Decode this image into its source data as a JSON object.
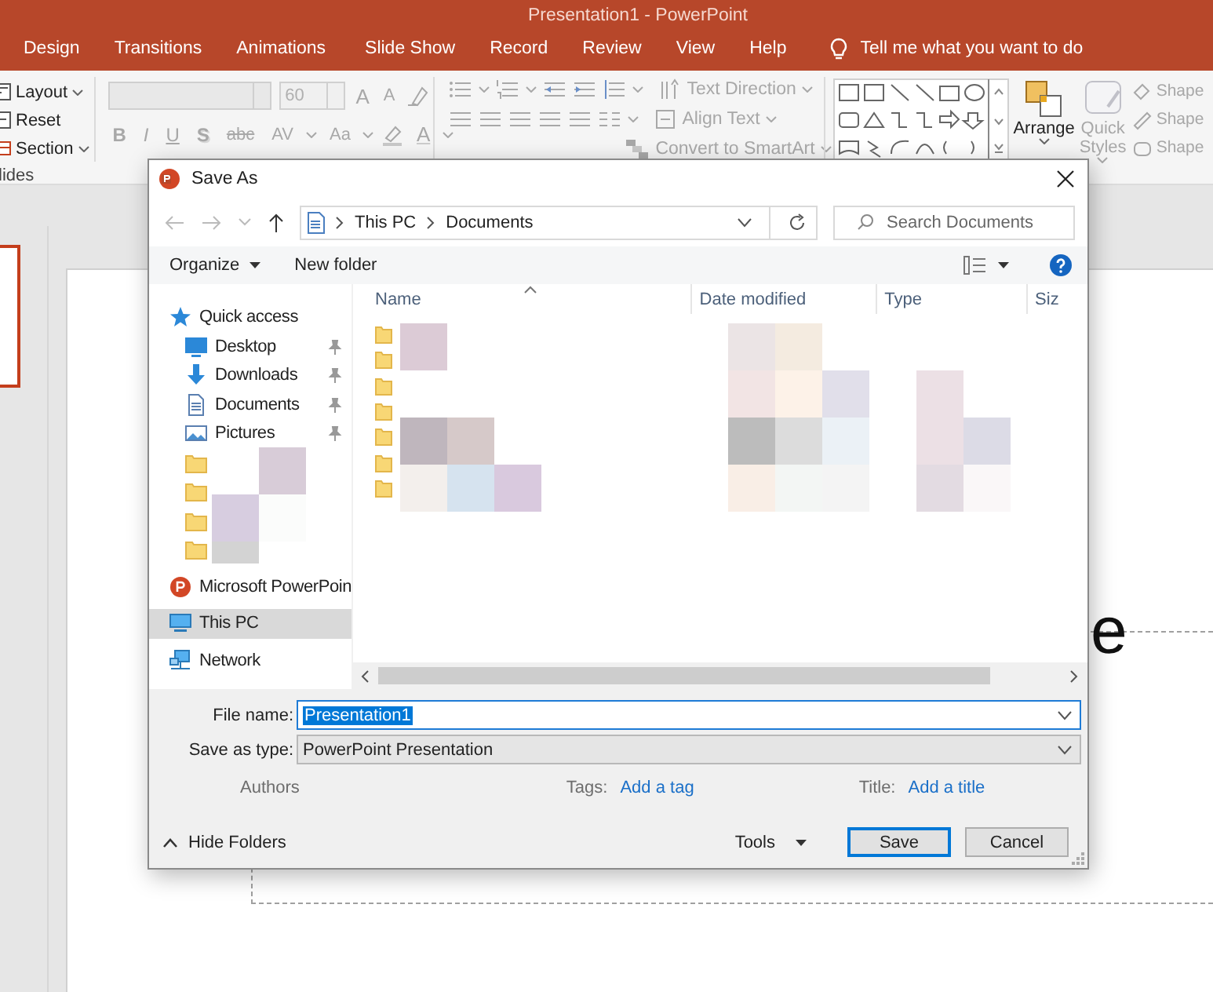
{
  "app_window": {
    "title": "Presentation1  -  PowerPoint"
  },
  "menu_tabs": [
    "Design",
    "Transitions",
    "Animations",
    "Slide Show",
    "Record",
    "Review",
    "View",
    "Help"
  ],
  "tell_me": "Tell me what you want to do",
  "ribbon": {
    "slides_commands": [
      {
        "label": "Layout",
        "dropdown": true
      },
      {
        "label": "Reset",
        "dropdown": false
      },
      {
        "label": "Section",
        "dropdown": true
      }
    ],
    "slides_group_label": "lides",
    "font_size": "60",
    "size_buttons": [
      "A",
      "A"
    ],
    "format_buttons": [
      {
        "label": "B",
        "kind": "bold"
      },
      {
        "label": "I",
        "kind": "italic"
      },
      {
        "label": "U",
        "kind": "underline"
      },
      {
        "label": "S",
        "kind": "shadow"
      },
      {
        "label": "abc",
        "kind": "strike"
      },
      {
        "label": "AV",
        "kind": "plain"
      },
      {
        "label": "Aa",
        "kind": "plain"
      },
      {
        "label": "A",
        "kind": "color"
      }
    ],
    "paragraph_commands": [
      "Text Direction",
      "Align Text",
      "Convert to SmartArt"
    ],
    "arrange": "Arrange",
    "quick_styles": [
      "Quick",
      "Styles"
    ],
    "shape_commands": [
      "Shape",
      "Shape",
      "Shape"
    ]
  },
  "slide_text_fragment": "e",
  "dialog": {
    "title": "Save As",
    "breadcrumb": [
      "This PC",
      "Documents"
    ],
    "search": {
      "placeholder": "Search Documents"
    },
    "organize": "Organize",
    "new_folder": "New folder",
    "nav_groups": [
      [
        {
          "label": "Quick access",
          "kind": "star",
          "selected": false,
          "children": [
            {
              "label": "Desktop",
              "kind": "desktop",
              "pinned": true,
              "selected": false
            },
            {
              "label": "Downloads",
              "kind": "download",
              "pinned": true,
              "selected": false
            },
            {
              "label": "Documents",
              "kind": "document",
              "pinned": true,
              "selected": false
            },
            {
              "label": "Pictures",
              "kind": "pictures",
              "pinned": true,
              "selected": false
            },
            {
              "kind": "folder",
              "pinned": false,
              "selected": false
            },
            {
              "kind": "folder",
              "pinned": false,
              "selected": false
            },
            {
              "kind": "folder",
              "pinned": false,
              "selected": false
            },
            {
              "kind": "folder",
              "pinned": false,
              "selected": false
            }
          ]
        }
      ],
      [
        {
          "label": "Microsoft PowerPoin",
          "kind": "powerpoint",
          "selected": false
        }
      ],
      [
        {
          "label": "This PC",
          "kind": "pc",
          "selected": true
        }
      ],
      [
        {
          "label": "Network",
          "kind": "network",
          "selected": false
        }
      ]
    ],
    "columns": [
      "Name",
      "Date modified",
      "Type",
      "Siz"
    ],
    "rows": [
      {
        "kind": "folder"
      },
      {
        "kind": "folder"
      },
      {
        "kind": "folder"
      },
      {
        "kind": "folder"
      },
      {
        "kind": "folder"
      },
      {
        "kind": "folder"
      },
      {
        "kind": "folder"
      }
    ],
    "file_name": {
      "label": "File name:",
      "value": "Presentation1"
    },
    "save_type": {
      "label": "Save as type:",
      "value": "PowerPoint Presentation"
    },
    "authors_label": "Authors",
    "tags": {
      "label": "Tags:",
      "link": "Add a tag"
    },
    "title_field": {
      "label": "Title:",
      "link": "Add a title"
    },
    "hide_folders": "Hide Folders",
    "tools": "Tools",
    "buttons": [
      {
        "label": "Save",
        "default": true
      },
      {
        "label": "Cancel",
        "default": false
      }
    ]
  }
}
